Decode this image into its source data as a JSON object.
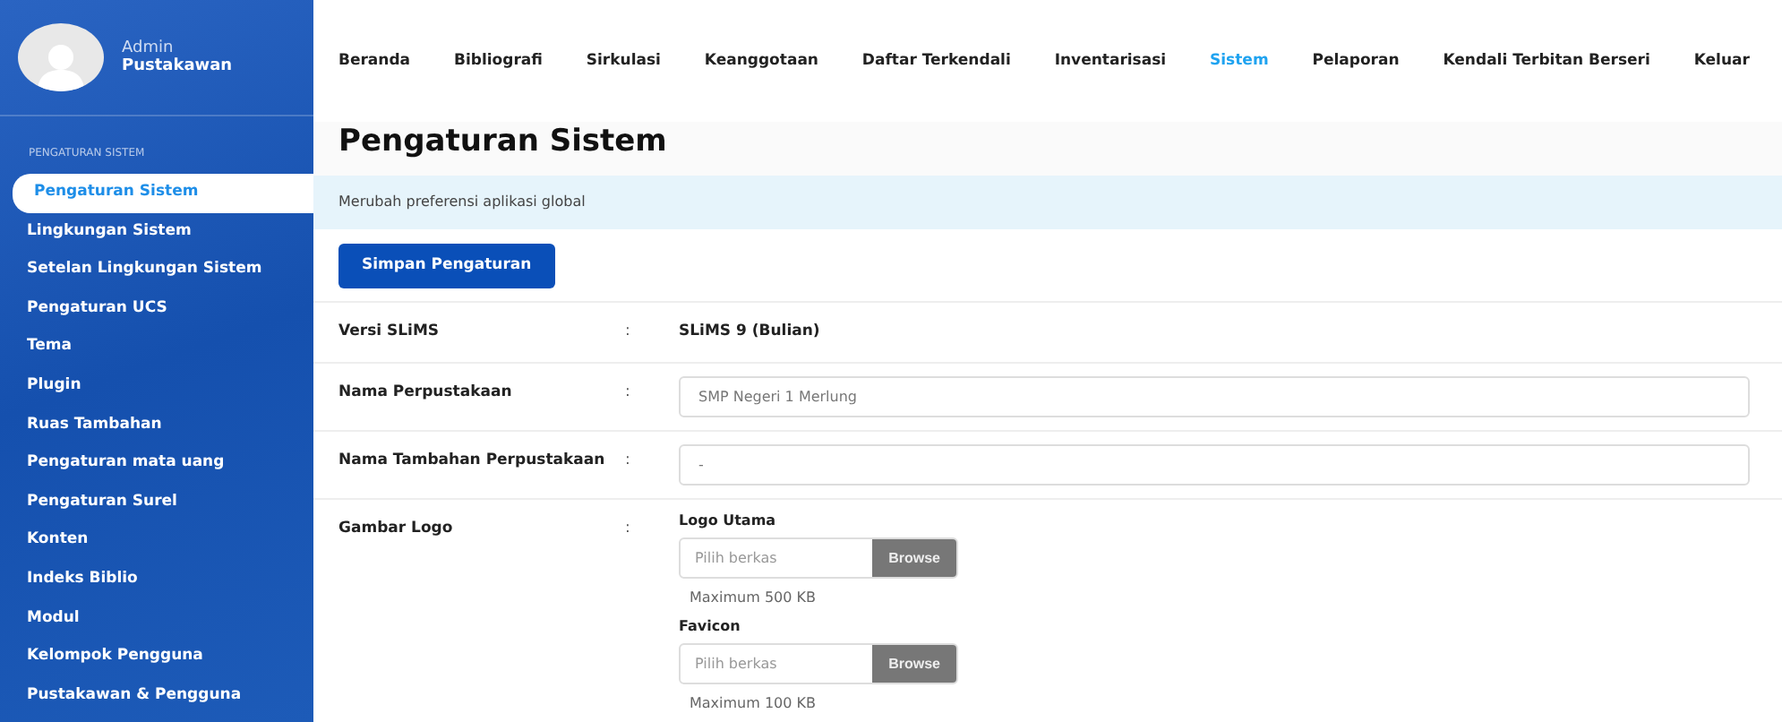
{
  "user": {
    "role": "Admin",
    "name": "Pustakawan"
  },
  "sidebar": {
    "section": "PENGATURAN SISTEM",
    "items": [
      {
        "label": "Pengaturan Sistem",
        "selected": true
      },
      {
        "label": "Lingkungan Sistem",
        "selected": false
      },
      {
        "label": "Setelan Lingkungan Sistem",
        "selected": false
      },
      {
        "label": "Pengaturan UCS",
        "selected": false
      },
      {
        "label": "Tema",
        "selected": false
      },
      {
        "label": "Plugin",
        "selected": false
      },
      {
        "label": "Ruas Tambahan",
        "selected": false
      },
      {
        "label": "Pengaturan mata uang",
        "selected": false
      },
      {
        "label": "Pengaturan Surel",
        "selected": false
      },
      {
        "label": "Konten",
        "selected": false
      },
      {
        "label": "Indeks Biblio",
        "selected": false
      },
      {
        "label": "Modul",
        "selected": false
      },
      {
        "label": "Kelompok Pengguna",
        "selected": false
      },
      {
        "label": "Pustakawan & Pengguna",
        "selected": false
      }
    ]
  },
  "nav": [
    {
      "label": "Beranda",
      "selected": false
    },
    {
      "label": "Bibliografi",
      "selected": false
    },
    {
      "label": "Sirkulasi",
      "selected": false
    },
    {
      "label": "Keanggotaan",
      "selected": false
    },
    {
      "label": "Daftar Terkendali",
      "selected": false
    },
    {
      "label": "Inventarisasi",
      "selected": false
    },
    {
      "label": "Sistem",
      "selected": true
    },
    {
      "label": "Pelaporan",
      "selected": false
    },
    {
      "label": "Kendali Terbitan Berseri",
      "selected": false
    },
    {
      "label": "Keluar",
      "selected": false
    }
  ],
  "page": {
    "title": "Pengaturan Sistem",
    "info": "Merubah preferensi aplikasi global",
    "save_button": "Simpan Pengaturan"
  },
  "form": [
    {
      "kind": "text",
      "label": "Versi SLiMS",
      "separator": ":",
      "value": "SLiMS 9 (Bulian)"
    },
    {
      "kind": "input",
      "label": "Nama Perpustakaan",
      "separator": ":",
      "value": "SMP Negeri 1 Merlung"
    },
    {
      "kind": "input",
      "label": "Nama Tambahan Perpustakaan",
      "separator": ":",
      "value": "-"
    },
    {
      "kind": "files",
      "label": "Gambar Logo",
      "separator": ":",
      "files": [
        {
          "title": "Logo Utama",
          "placeholder": "Pilih berkas",
          "button": "Browse",
          "hint": "Maximum 500 KB"
        },
        {
          "title": "Favicon",
          "placeholder": "Pilih berkas",
          "button": "Browse",
          "hint": "Maximum 100 KB"
        }
      ]
    }
  ]
}
